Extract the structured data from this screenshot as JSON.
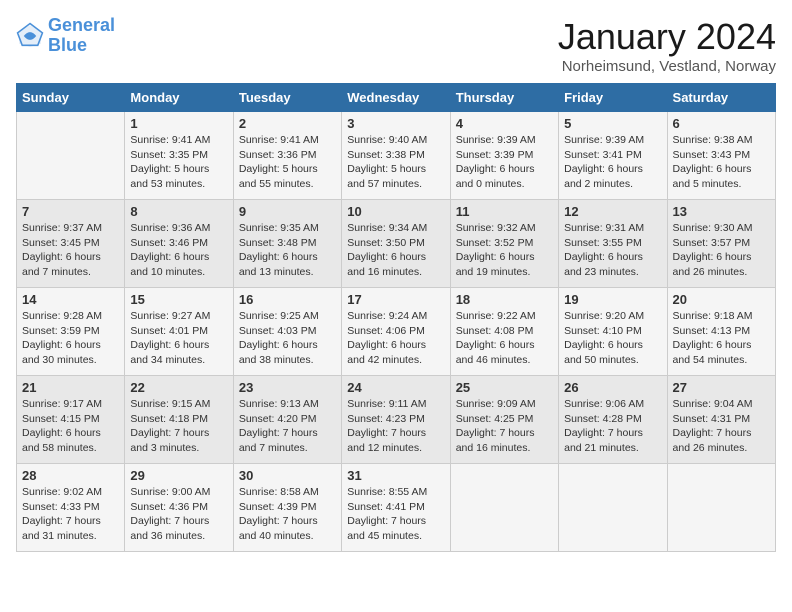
{
  "header": {
    "logo_line1": "General",
    "logo_line2": "Blue",
    "month": "January 2024",
    "location": "Norheimsund, Vestland, Norway"
  },
  "weekdays": [
    "Sunday",
    "Monday",
    "Tuesday",
    "Wednesday",
    "Thursday",
    "Friday",
    "Saturday"
  ],
  "weeks": [
    [
      {
        "day": "",
        "sunrise": "",
        "sunset": "",
        "daylight": ""
      },
      {
        "day": "1",
        "sunrise": "Sunrise: 9:41 AM",
        "sunset": "Sunset: 3:35 PM",
        "daylight": "Daylight: 5 hours and 53 minutes."
      },
      {
        "day": "2",
        "sunrise": "Sunrise: 9:41 AM",
        "sunset": "Sunset: 3:36 PM",
        "daylight": "Daylight: 5 hours and 55 minutes."
      },
      {
        "day": "3",
        "sunrise": "Sunrise: 9:40 AM",
        "sunset": "Sunset: 3:38 PM",
        "daylight": "Daylight: 5 hours and 57 minutes."
      },
      {
        "day": "4",
        "sunrise": "Sunrise: 9:39 AM",
        "sunset": "Sunset: 3:39 PM",
        "daylight": "Daylight: 6 hours and 0 minutes."
      },
      {
        "day": "5",
        "sunrise": "Sunrise: 9:39 AM",
        "sunset": "Sunset: 3:41 PM",
        "daylight": "Daylight: 6 hours and 2 minutes."
      },
      {
        "day": "6",
        "sunrise": "Sunrise: 9:38 AM",
        "sunset": "Sunset: 3:43 PM",
        "daylight": "Daylight: 6 hours and 5 minutes."
      }
    ],
    [
      {
        "day": "7",
        "sunrise": "Sunrise: 9:37 AM",
        "sunset": "Sunset: 3:45 PM",
        "daylight": "Daylight: 6 hours and 7 minutes."
      },
      {
        "day": "8",
        "sunrise": "Sunrise: 9:36 AM",
        "sunset": "Sunset: 3:46 PM",
        "daylight": "Daylight: 6 hours and 10 minutes."
      },
      {
        "day": "9",
        "sunrise": "Sunrise: 9:35 AM",
        "sunset": "Sunset: 3:48 PM",
        "daylight": "Daylight: 6 hours and 13 minutes."
      },
      {
        "day": "10",
        "sunrise": "Sunrise: 9:34 AM",
        "sunset": "Sunset: 3:50 PM",
        "daylight": "Daylight: 6 hours and 16 minutes."
      },
      {
        "day": "11",
        "sunrise": "Sunrise: 9:32 AM",
        "sunset": "Sunset: 3:52 PM",
        "daylight": "Daylight: 6 hours and 19 minutes."
      },
      {
        "day": "12",
        "sunrise": "Sunrise: 9:31 AM",
        "sunset": "Sunset: 3:55 PM",
        "daylight": "Daylight: 6 hours and 23 minutes."
      },
      {
        "day": "13",
        "sunrise": "Sunrise: 9:30 AM",
        "sunset": "Sunset: 3:57 PM",
        "daylight": "Daylight: 6 hours and 26 minutes."
      }
    ],
    [
      {
        "day": "14",
        "sunrise": "Sunrise: 9:28 AM",
        "sunset": "Sunset: 3:59 PM",
        "daylight": "Daylight: 6 hours and 30 minutes."
      },
      {
        "day": "15",
        "sunrise": "Sunrise: 9:27 AM",
        "sunset": "Sunset: 4:01 PM",
        "daylight": "Daylight: 6 hours and 34 minutes."
      },
      {
        "day": "16",
        "sunrise": "Sunrise: 9:25 AM",
        "sunset": "Sunset: 4:03 PM",
        "daylight": "Daylight: 6 hours and 38 minutes."
      },
      {
        "day": "17",
        "sunrise": "Sunrise: 9:24 AM",
        "sunset": "Sunset: 4:06 PM",
        "daylight": "Daylight: 6 hours and 42 minutes."
      },
      {
        "day": "18",
        "sunrise": "Sunrise: 9:22 AM",
        "sunset": "Sunset: 4:08 PM",
        "daylight": "Daylight: 6 hours and 46 minutes."
      },
      {
        "day": "19",
        "sunrise": "Sunrise: 9:20 AM",
        "sunset": "Sunset: 4:10 PM",
        "daylight": "Daylight: 6 hours and 50 minutes."
      },
      {
        "day": "20",
        "sunrise": "Sunrise: 9:18 AM",
        "sunset": "Sunset: 4:13 PM",
        "daylight": "Daylight: 6 hours and 54 minutes."
      }
    ],
    [
      {
        "day": "21",
        "sunrise": "Sunrise: 9:17 AM",
        "sunset": "Sunset: 4:15 PM",
        "daylight": "Daylight: 6 hours and 58 minutes."
      },
      {
        "day": "22",
        "sunrise": "Sunrise: 9:15 AM",
        "sunset": "Sunset: 4:18 PM",
        "daylight": "Daylight: 7 hours and 3 minutes."
      },
      {
        "day": "23",
        "sunrise": "Sunrise: 9:13 AM",
        "sunset": "Sunset: 4:20 PM",
        "daylight": "Daylight: 7 hours and 7 minutes."
      },
      {
        "day": "24",
        "sunrise": "Sunrise: 9:11 AM",
        "sunset": "Sunset: 4:23 PM",
        "daylight": "Daylight: 7 hours and 12 minutes."
      },
      {
        "day": "25",
        "sunrise": "Sunrise: 9:09 AM",
        "sunset": "Sunset: 4:25 PM",
        "daylight": "Daylight: 7 hours and 16 minutes."
      },
      {
        "day": "26",
        "sunrise": "Sunrise: 9:06 AM",
        "sunset": "Sunset: 4:28 PM",
        "daylight": "Daylight: 7 hours and 21 minutes."
      },
      {
        "day": "27",
        "sunrise": "Sunrise: 9:04 AM",
        "sunset": "Sunset: 4:31 PM",
        "daylight": "Daylight: 7 hours and 26 minutes."
      }
    ],
    [
      {
        "day": "28",
        "sunrise": "Sunrise: 9:02 AM",
        "sunset": "Sunset: 4:33 PM",
        "daylight": "Daylight: 7 hours and 31 minutes."
      },
      {
        "day": "29",
        "sunrise": "Sunrise: 9:00 AM",
        "sunset": "Sunset: 4:36 PM",
        "daylight": "Daylight: 7 hours and 36 minutes."
      },
      {
        "day": "30",
        "sunrise": "Sunrise: 8:58 AM",
        "sunset": "Sunset: 4:39 PM",
        "daylight": "Daylight: 7 hours and 40 minutes."
      },
      {
        "day": "31",
        "sunrise": "Sunrise: 8:55 AM",
        "sunset": "Sunset: 4:41 PM",
        "daylight": "Daylight: 7 hours and 45 minutes."
      },
      {
        "day": "",
        "sunrise": "",
        "sunset": "",
        "daylight": ""
      },
      {
        "day": "",
        "sunrise": "",
        "sunset": "",
        "daylight": ""
      },
      {
        "day": "",
        "sunrise": "",
        "sunset": "",
        "daylight": ""
      }
    ]
  ]
}
